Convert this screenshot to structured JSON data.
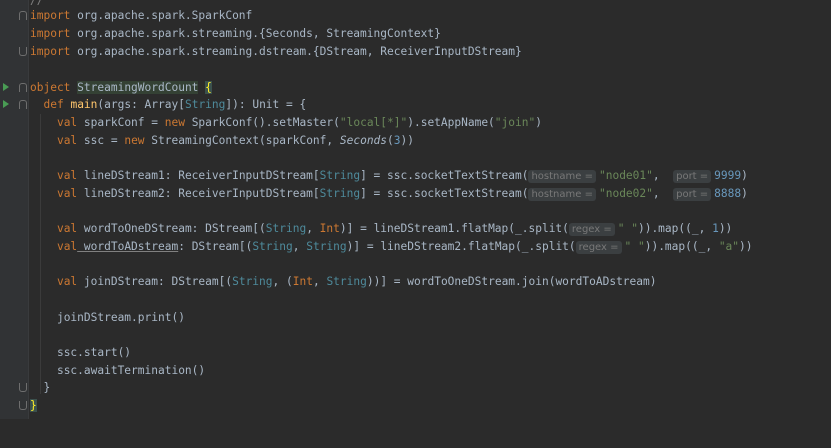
{
  "editor": {
    "lines": [
      {
        "p0": "//"
      },
      {
        "k": "import",
        "r": " org.apache.spark.SparkConf"
      },
      {
        "k": "import",
        "r": " org.apache.spark.streaming.{Seconds, StreamingContext}"
      },
      {
        "k": "import",
        "r": " org.apache.spark.streaming.dstream.{DStream, ReceiverInputDStream}"
      },
      {},
      {
        "k": "object",
        "r": " ",
        "name": "StreamingWordCount",
        "b": " {"
      },
      {},
      {},
      {},
      {},
      {},
      {},
      {},
      {},
      {},
      {},
      {},
      {},
      {},
      {},
      {},
      {}
    ],
    "obj_kw": "object",
    "obj_name": "StreamingWordCount",
    "brace_open": "{",
    "def_kw": "def",
    "main_name": "main",
    "main_sig_a": "(args: Array[",
    "string_t": "String",
    "main_sig_b": "]): Unit = {",
    "l_conf": {
      "val": "val",
      "a": " sparkConf = ",
      "new": "new",
      "b": " SparkConf().setMaster(",
      "s1": "\"local[*]\"",
      "c": ").setAppName(",
      "s2": "\"join\"",
      "d": ")"
    },
    "l_ssc": {
      "val": "val",
      "a": " ssc = ",
      "new": "new",
      "b": " StreamingContext(sparkConf, ",
      "sec": "Seconds",
      "c": "(",
      "n": "3",
      "d": "))"
    },
    "l_ld1": {
      "val": "val",
      "a": " lineDStream1: ReceiverInputDStream[",
      "t": "String",
      "b": "] = ssc.socketTextStream(",
      "h1": "hostname =",
      "s": "\"node01\"",
      "c": ",",
      "h2": "port =",
      "n": "9999",
      "d": ")"
    },
    "l_ld2": {
      "val": "val",
      "a": " lineDStream2: ReceiverInputDStream[",
      "t": "String",
      "b": "] = ssc.socketTextStream(",
      "h1": "hostname =",
      "s": "\"node02\"",
      "c": ",",
      "h2": "port =",
      "n": "8888",
      "d": ")"
    },
    "l_w1": {
      "val": "val",
      "a": " wordToOneDStream: DStream[(",
      "t1": "String",
      "c": ", ",
      "t2": "Int",
      "b": ")] = lineDStream1.flatMap(_.split(",
      "h": "regex =",
      "s": "\" \"",
      "d": ")).map((_, ",
      "n": "1",
      "e": "))"
    },
    "l_w2": {
      "val": "val",
      "a": " wordToADstream",
      "a2": ": DStream[(",
      "t1": "String",
      "c": ", ",
      "t2": "String",
      "b": ")] = lineDStream2.flatMap(_.split(",
      "h": "regex =",
      "s": "\" \"",
      "d": ")).map((_, ",
      "s2": "\"a\"",
      "e": "))"
    },
    "l_join": {
      "val": "val",
      "a": " joinDStream: DStream[(",
      "t1": "String",
      "c": ", (",
      "t2": "Int",
      "c2": ", ",
      "t3": "String",
      "b": "))] = wordToOneDStream.join(wordToADstream)"
    },
    "l_print": "joinDStream.print()",
    "l_start": "ssc.start()",
    "l_await": "ssc.awaitTermination()",
    "l_close1": "}",
    "l_close2": "}"
  }
}
